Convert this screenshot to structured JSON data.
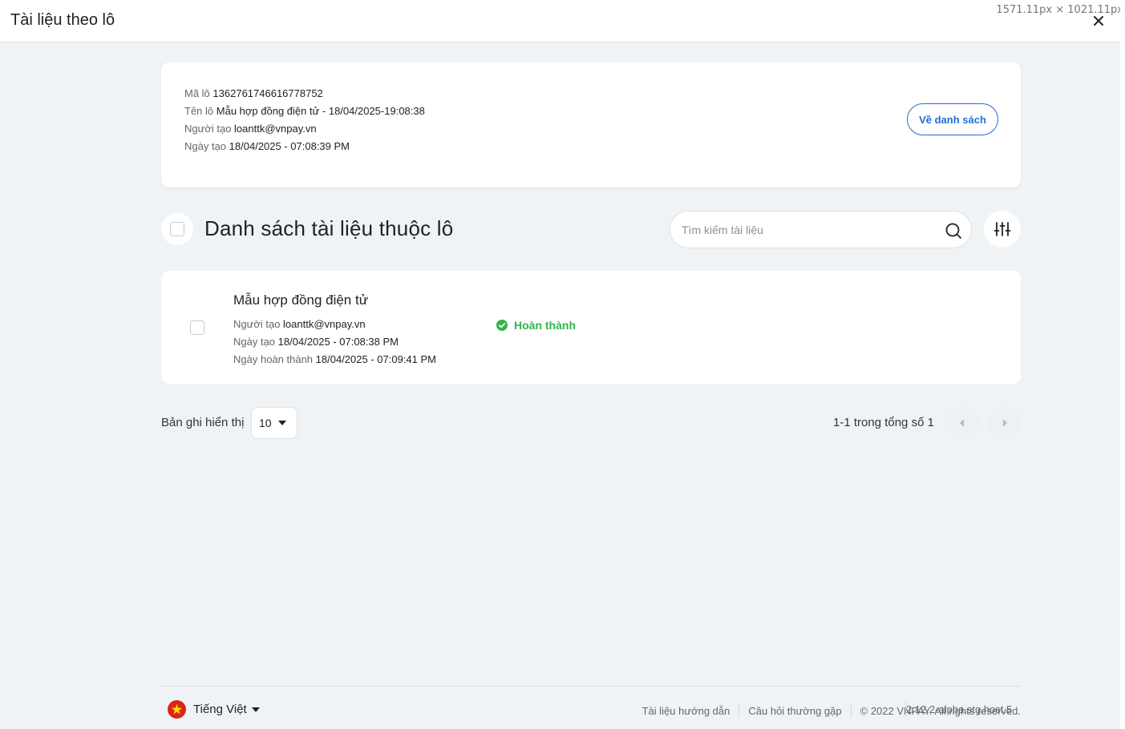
{
  "window": {
    "title": "Tài liệu theo lô",
    "dimensions_readout": "1571.11px × 1021.11px"
  },
  "batch": {
    "code_label": "Mã lô",
    "code_value": "1362761746616778752",
    "name_label": "Tên lô",
    "name_value": "Mẫu hợp đồng điện tử - 18/04/2025-19:08:38",
    "creator_label": "Người tạo",
    "creator_value": "loanttk@vnpay.vn",
    "created_label": "Ngày tạo",
    "created_value": "18/04/2025 - 07:08:39 PM",
    "back_button_label": "Về danh sách"
  },
  "list": {
    "title": "Danh sách tài liệu thuộc lô",
    "search_placeholder": "Tìm kiếm tài liệu",
    "search_value": ""
  },
  "documents": [
    {
      "title": "Mẫu hợp đồng điện tử",
      "creator_label": "Người tạo",
      "creator_value": "loanttk@vnpay.vn",
      "created_label": "Ngày tạo",
      "created_value": "18/04/2025 - 07:08:38 PM",
      "completed_label": "Ngày hoàn thành",
      "completed_value": "18/04/2025 - 07:09:41 PM",
      "status": "Hoàn thành",
      "status_color": "#33b44a"
    }
  ],
  "pagination": {
    "rows_label": "Bản ghi hiển thị",
    "rows_value": "10",
    "range_text": "1-1 trong tổng số 1"
  },
  "footer": {
    "language": "Tiếng Việt",
    "links": [
      "Tài liệu hướng dẫn",
      "Câu hỏi thường gặp"
    ],
    "copyright": "© 2022 VNPAY. All rights reserved.",
    "version": "2.12.2-alpha.stg.host.5"
  },
  "colors": {
    "accent": "#1f6fd1",
    "success": "#33b44a",
    "background": "#f0f3f5"
  },
  "icons": [
    "close-icon",
    "search-icon",
    "filter-sliders-icon",
    "check-circle-icon",
    "chevron-left-icon",
    "chevron-right-icon",
    "caret-down-icon",
    "vietnam-flag-icon"
  ]
}
